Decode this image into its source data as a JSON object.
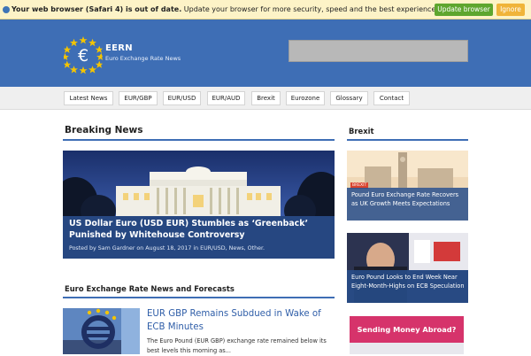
{
  "browser_warning": {
    "bold": "Your web browser (Safari 4) is out of date.",
    "text": "Update your browser for more security, speed and the best experience on this site.",
    "update_label": "Update browser",
    "ignore_label": "Ignore"
  },
  "header": {
    "site_title": "EERN",
    "site_subtitle": "Euro Exchange Rate News",
    "logo_symbol": "€",
    "search_value": ""
  },
  "nav": {
    "items": [
      "Latest News",
      "EUR/GBP",
      "EUR/USD",
      "EUR/AUD",
      "Brexit",
      "Eurozone",
      "Glossary",
      "Contact"
    ]
  },
  "breaking_news": {
    "section_title": "Breaking News",
    "headline": "US Dollar Euro (USD EUR) Stumbles as ‘Greenback’ Punished by Whitehouse Controversy",
    "meta": "Posted by Sam Gardner on August 18, 2017 in EUR/USD, News, Other."
  },
  "sidebar": {
    "section_title": "Brexit",
    "cards": [
      {
        "title": "Pound Euro Exchange Rate Recovers as UK Growth Meets Expectations",
        "tag": "BREXIT"
      },
      {
        "title": "Euro Pound Looks to End Week Near Eight-Month-Highs on ECB Speculation"
      }
    ],
    "ad_text": "Sending Money Abroad?"
  },
  "forecasts": {
    "section_title": "Euro Exchange Rate News and Forecasts",
    "article_title": "EUR GBP Remains Subdued in Wake of ECB Minutes",
    "article_excerpt": "The Euro Pound (EUR GBP) exchange rate remained below its best levels this morning as..."
  },
  "colors": {
    "brand_blue": "#3e6eb5",
    "link_blue": "#2f5ea8",
    "update_green": "#5ea62e",
    "ignore_orange": "#f0b43a",
    "ad_pink": "#d6336b"
  }
}
